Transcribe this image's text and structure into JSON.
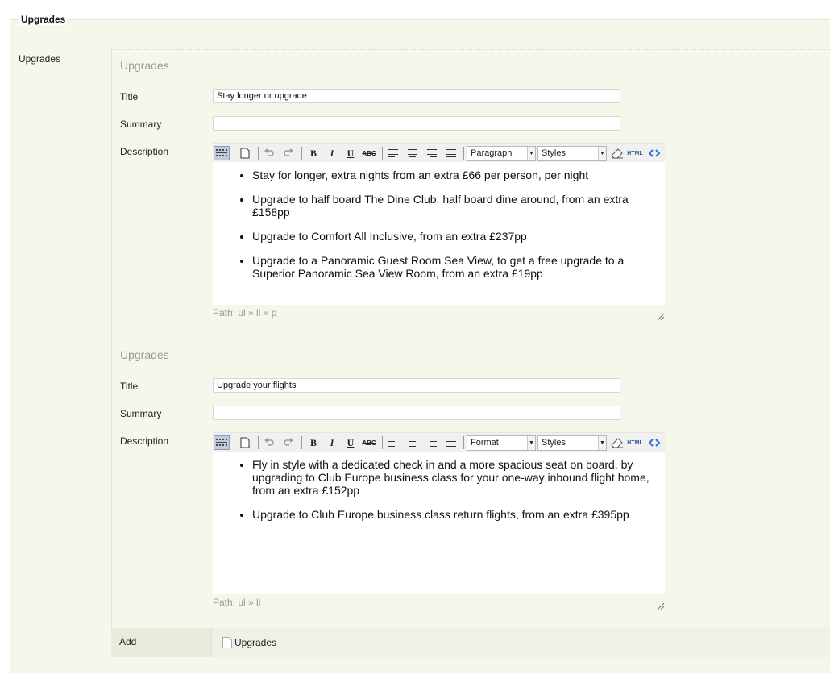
{
  "legend": "Upgrades",
  "outer_label": "Upgrades",
  "toolbar": {
    "styles_label": "Styles",
    "html_label": "HTML"
  },
  "groups": [
    {
      "title": "Upgrades",
      "title_label": "Title",
      "title_value": "Stay longer or upgrade",
      "summary_label": "Summary",
      "summary_value": "",
      "description_label": "Description",
      "format_value": "Paragraph",
      "items": [
        "Stay for longer, extra nights from an extra £66 per person, per night",
        "Upgrade to half board The Dine Club, half board dine around, from an extra £158pp",
        "Upgrade to Comfort All Inclusive, from an extra £237pp",
        "Upgrade to a Panoramic Guest Room Sea View, to get a free upgrade to a Superior Panoramic Sea View Room, from an extra £19pp"
      ],
      "path": "Path: ul » li » p"
    },
    {
      "title": "Upgrades",
      "title_label": "Title",
      "title_value": "Upgrade your flights",
      "summary_label": "Summary",
      "summary_value": "",
      "description_label": "Description",
      "format_value": "Format",
      "items": [
        "Fly in style with a dedicated check in and a more spacious seat on board, by upgrading to Club Europe business class for your one-way inbound flight home, from an extra £152pp",
        "Upgrade to Club Europe business class return flights, from an extra £395pp"
      ],
      "path": "Path: ul » li"
    }
  ],
  "add": {
    "label": "Add",
    "link_label": "Upgrades"
  }
}
